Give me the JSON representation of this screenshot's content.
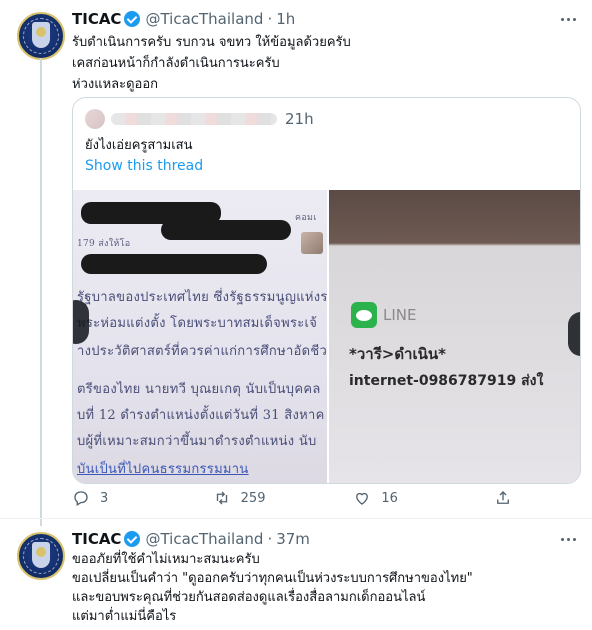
{
  "tweet1": {
    "name": "TICAC",
    "handle": "@TicacThailand",
    "dot": "·",
    "time": "1h",
    "lines": [
      "รับดำเนินการครับ รบกวน จขทว ให้ข้อมูลด้วยครับ",
      "เคสก่อนหน้าก็กำลังดำเนินการนะครับ",
      "ห่วงแหละดูออก"
    ],
    "quote": {
      "time": "21h",
      "text": "ยังไงเอ่ยครูสามเสน",
      "show_thread": "Show this thread",
      "photo_left": {
        "lines": [
          "179 ส่งให้โอ",
          "รัฐบาลของประเทศไทย ซึ่งรัฐธรรมนูญแห่งร",
          "พระห่อมแต่งตั้ง โดยพระบาทสมเด็จพระเจ้",
          "างประวัติศาสตร์ที่ควรค่าแก่การศึกษาอัดชีว",
          "ตรีของไทย นายทวี บุณยเกตุ นับเป็นบุคคล",
          "บที่ 12 ดำรงตำแหน่งตั้งแต่วันที่ 31 สิงหาค",
          "บผู้ที่เหมาะสมกว่าขึ้นมาดำรงตำแหน่ง นับ",
          "บันเป็นที่ไปคนธรรมกรรมมาน"
        ],
        "corner": "คอมเ"
      },
      "photo_right": {
        "app": "LINE",
        "line1": "*วารี>ดำเนิน*",
        "line2": "internet-0986787919 ส่งใ"
      }
    },
    "actions": {
      "reply_count": "3",
      "retweet_count": "259",
      "like_count": "16"
    }
  },
  "tweet2": {
    "name": "TICAC",
    "handle": "@TicacThailand",
    "dot": "·",
    "time": "37m",
    "lines": [
      "ขออภัยที่ใช้คำไม่เหมาะสมนะครับ",
      "ขอเปลี่ยนเป็นคำว่า \"ดูออกครับว่าทุกคนเป็นห่วงระบบการศึกษาของไทย\"",
      "และขอบพระคุณที่ช่วยกันสอดส่องดูแลเรื่องสื่อลามกเด็กออนไลน์",
      "แต่มาต่ำแม่นี่คือไร"
    ]
  }
}
